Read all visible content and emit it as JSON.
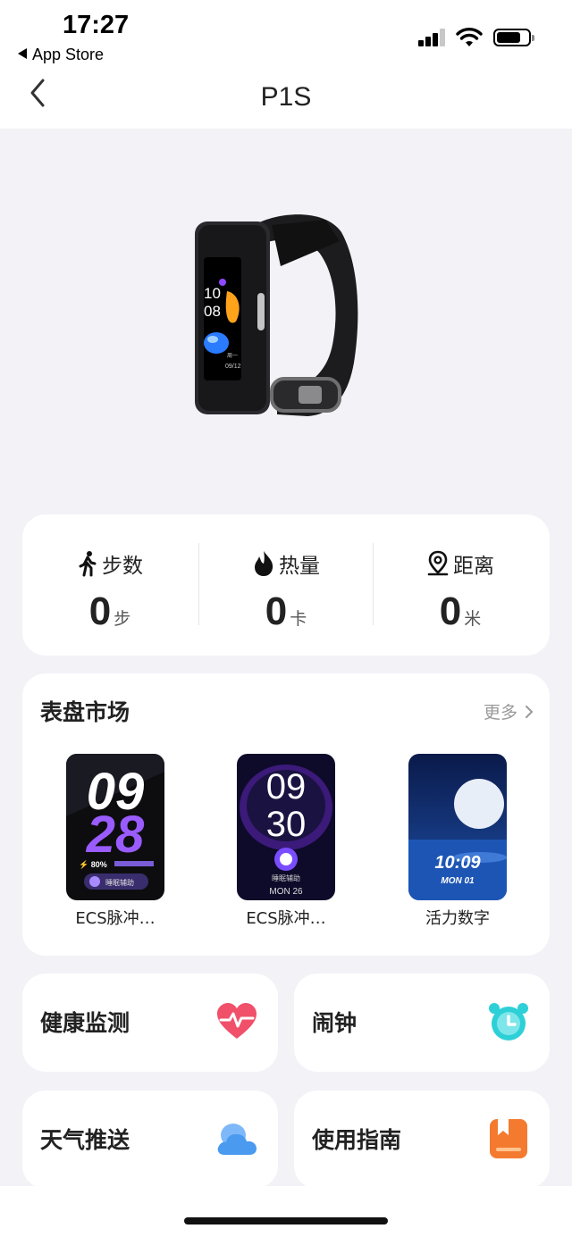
{
  "status_bar": {
    "time": "17:27",
    "back_app": "App Store"
  },
  "nav": {
    "title": "P1S"
  },
  "stats": [
    {
      "icon": "walking-icon",
      "label": "步数",
      "value": "0",
      "unit": "步"
    },
    {
      "icon": "flame-icon",
      "label": "热量",
      "value": "0",
      "unit": "卡"
    },
    {
      "icon": "location-pin-icon",
      "label": "距离",
      "value": "0",
      "unit": "米"
    }
  ],
  "watch_face_market": {
    "title": "表盘市场",
    "more": "更多",
    "faces": [
      {
        "name": "ECS脉冲…",
        "preview": {
          "top": "09",
          "bottom": "28",
          "battery": "80%",
          "badge": "睡眠辅助"
        }
      },
      {
        "name": "ECS脉冲…",
        "preview": {
          "top": "09",
          "bottom": "30",
          "badge": "睡眠辅助",
          "date": "MON 26"
        }
      },
      {
        "name": "活力数字",
        "preview": {
          "time": "10:09",
          "date": "MON 01"
        }
      }
    ]
  },
  "device_preview": {
    "hour": "10",
    "minute": "08",
    "weekday": "周一",
    "date": "09/12"
  },
  "features": [
    {
      "label": "健康监测",
      "icon": "heart-rate-icon",
      "color": "#f0506a"
    },
    {
      "label": "闹钟",
      "icon": "alarm-clock-icon",
      "color": "#2ed0d8"
    },
    {
      "label": "天气推送",
      "icon": "cloud-icon",
      "color": "#4a9af0"
    },
    {
      "label": "使用指南",
      "icon": "guide-book-icon",
      "color": "#f47a30"
    }
  ]
}
